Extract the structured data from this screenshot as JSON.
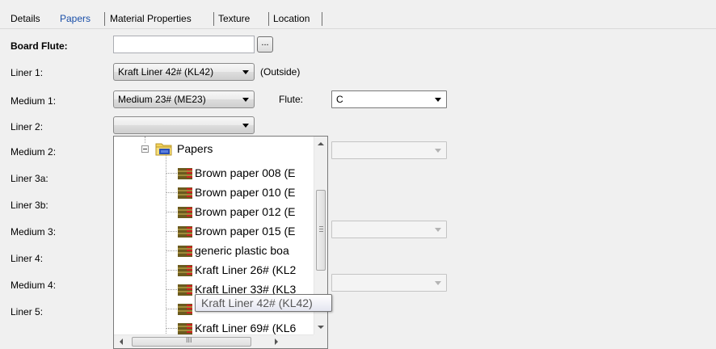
{
  "tabs": [
    {
      "label": "Details",
      "active": false
    },
    {
      "label": "Papers",
      "active": true
    },
    {
      "label": "Material Properties",
      "active": false
    },
    {
      "label": "Texture",
      "active": false
    },
    {
      "label": "Location",
      "active": false
    }
  ],
  "fields": {
    "board_flute": {
      "label": "Board Flute:",
      "value": "",
      "browse_label": "..."
    },
    "liner1": {
      "label": "Liner 1:",
      "value": "Kraft Liner 42# (KL42)",
      "note": "(Outside)"
    },
    "medium1": {
      "label": "Medium 1:",
      "value": "Medium 23# (ME23)"
    },
    "flute": {
      "label": "Flute:",
      "value": "C"
    },
    "liner2": {
      "label": "Liner 2:",
      "value": ""
    },
    "medium2": {
      "label": "Medium 2:"
    },
    "liner3a": {
      "label": "Liner 3a:"
    },
    "liner3b": {
      "label": "Liner 3b:"
    },
    "medium3": {
      "label": "Medium 3:"
    },
    "liner4": {
      "label": "Liner 4:"
    },
    "medium4": {
      "label": "Medium 4:"
    },
    "liner5": {
      "label": "Liner 5:"
    }
  },
  "tree": {
    "folder": "Papers",
    "items": [
      "Brown paper 008 (E",
      "Brown paper 010 (E",
      "Brown paper 012 (E",
      "Brown paper 015 (E",
      "generic plastic boa",
      "Kraft Liner 26# (KL2",
      "Kraft Liner 33# (KL3",
      "",
      "Kraft Liner 69# (KL6"
    ],
    "tooltip": "Kraft Liner 42# (KL42)",
    "scroll_grip_glyph": "≡",
    "hscroll_grip_glyph": "III"
  },
  "colors": {
    "active_tab": "#1a4fa8",
    "paper_icon_dark": "#6b5a1e",
    "paper_icon_light": "#a08a3a",
    "paper_icon_accent": "#cc2222",
    "folder_yellow": "#f3d35a"
  }
}
